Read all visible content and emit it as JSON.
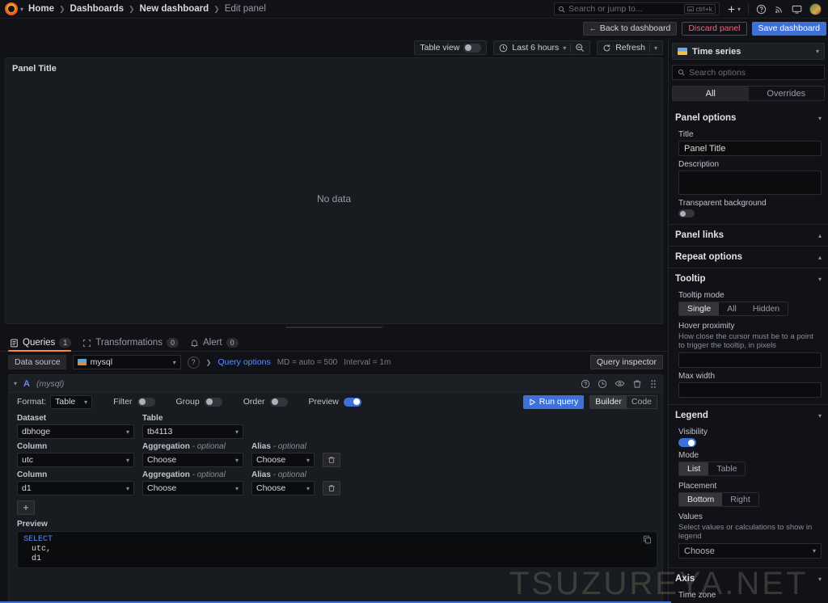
{
  "nav": {
    "breadcrumb": [
      "Home",
      "Dashboards",
      "New dashboard",
      "Edit panel"
    ],
    "search_placeholder": "Search or jump to...",
    "search_shortcut": "ctrl+k",
    "icons": [
      "plus-icon",
      "chevron-down-icon",
      "help-circle-icon",
      "news-icon",
      "screenshot-icon",
      "avatar"
    ]
  },
  "actions": {
    "back_to_dashboard": "Back to dashboard",
    "discard_panel": "Discard panel",
    "save_dashboard": "Save dashboard"
  },
  "panel_toolbar": {
    "table_view_label": "Table view",
    "table_view_on": false,
    "time_range": "Last 6 hours",
    "refresh_label": "Refresh"
  },
  "viz": {
    "panel_title": "Panel Title",
    "no_data": "No data"
  },
  "query_tabs": [
    {
      "label": "Queries",
      "count": "1",
      "icon": "queries-icon",
      "active": true
    },
    {
      "label": "Transformations",
      "count": "0",
      "icon": "transformations-icon",
      "active": false
    },
    {
      "label": "Alert",
      "count": "0",
      "icon": "bell-icon",
      "active": false
    }
  ],
  "datasource_row": {
    "label": "Data source",
    "value": "mysql",
    "query_options": "Query options",
    "meta_md": "MD = auto = 500",
    "meta_interval": "Interval = 1m",
    "query_inspector": "Query inspector"
  },
  "query": {
    "name": "A",
    "datasource": "(mysql)",
    "format_label": "Format:",
    "format_value": "Table",
    "filter_label": "Filter",
    "filter_on": false,
    "group_label": "Group",
    "group_on": false,
    "order_label": "Order",
    "order_on": false,
    "preview_label": "Preview",
    "preview_on": true,
    "run_query": "Run query",
    "builder": "Builder",
    "code": "Code",
    "dataset_label": "Dataset",
    "dataset_value": "dbhoge",
    "table_label": "Table",
    "table_value": "tb4113",
    "column_label": "Column",
    "aggregation_label": "Aggregation",
    "alias_label": "Alias",
    "optional_suffix": "- optional",
    "choose": "Choose",
    "columns": [
      {
        "column": "utc",
        "aggregation": "Choose",
        "alias": "Choose"
      },
      {
        "column": "d1",
        "aggregation": "Choose",
        "alias": "Choose"
      }
    ],
    "add_label": "+",
    "preview_section_label": "Preview",
    "sql": {
      "line1": "SELECT",
      "line2": "utc,",
      "line3": "d1"
    }
  },
  "options": {
    "viz_name": "Time series",
    "search_placeholder": "Search options",
    "tab_all": "All",
    "tab_overrides": "Overrides",
    "panel_options": {
      "title": "Panel options",
      "title_label": "Title",
      "title_value": "Panel Title",
      "description_label": "Description",
      "description_value": "",
      "transparent_label": "Transparent background",
      "transparent_on": false
    },
    "panel_links": {
      "title": "Panel links"
    },
    "repeat_options": {
      "title": "Repeat options"
    },
    "tooltip": {
      "title": "Tooltip",
      "mode_label": "Tooltip mode",
      "modes": [
        "Single",
        "All",
        "Hidden"
      ],
      "mode_selected": "Single",
      "hover_label": "Hover proximity",
      "hover_desc": "How close the cursor must be to a point to trigger the tooltip, in pixels",
      "hover_value": "",
      "max_width_label": "Max width",
      "max_width_value": ""
    },
    "legend": {
      "title": "Legend",
      "visibility_label": "Visibility",
      "visibility_on": true,
      "mode_label": "Mode",
      "modes": [
        "List",
        "Table"
      ],
      "mode_selected": "List",
      "placement_label": "Placement",
      "placements": [
        "Bottom",
        "Right"
      ],
      "placement_selected": "Bottom",
      "values_label": "Values",
      "values_desc": "Select values or calculations to show in legend",
      "values_value": "Choose"
    },
    "axis": {
      "title": "Axis",
      "time_zone_label": "Time zone"
    }
  },
  "watermark": "TSUZUREYA.NET",
  "colors": {
    "accent_blue": "#3d71d9",
    "accent_orange": "#ff8833",
    "danger": "#f0667a"
  }
}
